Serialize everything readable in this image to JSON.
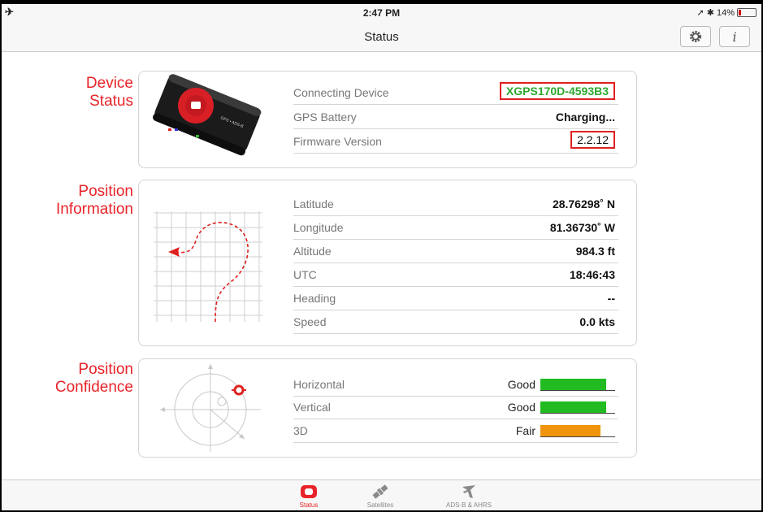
{
  "status_bar": {
    "time": "2:47 PM",
    "battery": "14%"
  },
  "navbar": {
    "title": "Status"
  },
  "device_status": {
    "title_line1": "Device",
    "title_line2": "Status",
    "rows": [
      {
        "label": "Connecting Device",
        "value": "XGPS170D-4593B3"
      },
      {
        "label": "GPS Battery",
        "value": "Charging..."
      },
      {
        "label": "Firmware Version",
        "value": "2.2.12"
      }
    ]
  },
  "position_info": {
    "title_line1": "Position",
    "title_line2": "Information",
    "rows": [
      {
        "label": "Latitude",
        "value": "28.76298˚ N"
      },
      {
        "label": "Longitude",
        "value": "81.36730˚ W"
      },
      {
        "label": "Altitude",
        "value": "984.3 ft"
      },
      {
        "label": "UTC",
        "value": "18:46:43"
      },
      {
        "label": "Heading",
        "value": "--"
      },
      {
        "label": "Speed",
        "value": "0.0 kts"
      }
    ]
  },
  "position_confidence": {
    "title_line1": "Position",
    "title_line2": "Confidence",
    "rows": [
      {
        "label": "Horizontal",
        "quality": "Good",
        "level": 0.88,
        "color": "#22bb22"
      },
      {
        "label": "Vertical",
        "quality": "Good",
        "level": 0.88,
        "color": "#22bb22"
      },
      {
        "label": "3D",
        "quality": "Fair",
        "level": 0.8,
        "color": "#f0940c"
      }
    ]
  },
  "colors": {
    "accent": "#e8242a",
    "good": "#22bb22",
    "fair": "#f0940c"
  },
  "tabs": [
    {
      "label": "Status",
      "icon": "status-icon",
      "active": true
    },
    {
      "label": "Satellites",
      "icon": "satellite-icon",
      "active": false
    },
    {
      "label": "ADS-B & AHRS",
      "icon": "airplane-icon",
      "active": false
    }
  ]
}
